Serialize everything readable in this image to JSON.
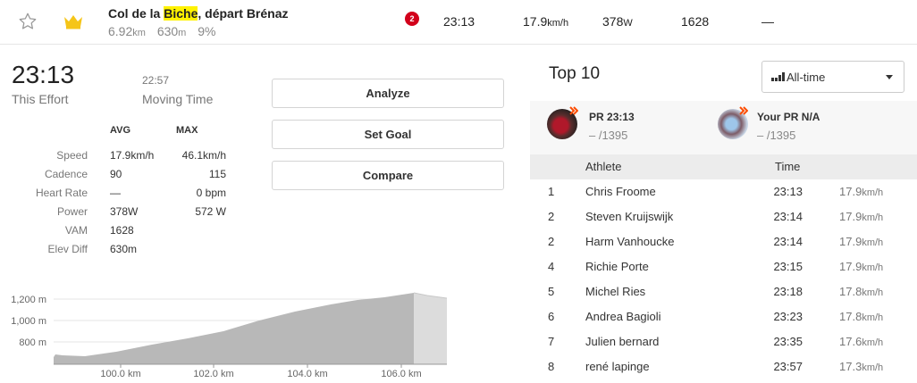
{
  "segment": {
    "name_before": "Col de la ",
    "name_highlight": "Biche",
    "name_after": ", départ Brénaz",
    "distance": "6.92",
    "distance_unit": "km",
    "elevation": "630",
    "elevation_unit": "m",
    "grade": "9%",
    "badge": "2",
    "time": "23:13",
    "speed": "17.9",
    "speed_unit": "km/h",
    "power": "378",
    "power_unit": "W",
    "vam": "1628",
    "hr": "—"
  },
  "effort": {
    "time": "23:13",
    "time_label": "This Effort",
    "moving_time": "22:57",
    "moving_label": "Moving Time"
  },
  "stats": {
    "col_avg": "AVG",
    "col_max": "MAX",
    "rows": [
      {
        "label": "Speed",
        "avg": "17.9km/h",
        "max": "46.1km/h"
      },
      {
        "label": "Cadence",
        "avg": "90",
        "max": "115"
      },
      {
        "label": "Heart Rate",
        "avg": "—",
        "max": "0 bpm"
      },
      {
        "label": "Power",
        "avg": "378W",
        "max": "572 W"
      },
      {
        "label": "VAM",
        "avg": "1628",
        "max": ""
      },
      {
        "label": "Elev Diff",
        "avg": "630m",
        "max": ""
      }
    ]
  },
  "buttons": {
    "analyze": "Analyze",
    "set_goal": "Set Goal",
    "compare": "Compare"
  },
  "elevation_chart": {
    "y_ticks": [
      "1,200 m",
      "1,000 m",
      "800 m"
    ],
    "x_ticks": [
      "100.0 km",
      "102.0 km",
      "104.0 km",
      "106.0 km"
    ]
  },
  "leaderboard": {
    "title": "Top 10",
    "filter": "All-time",
    "pr": {
      "label": "PR",
      "time": "23:13",
      "rank": "– /1395"
    },
    "your_pr": {
      "label": "Your PR",
      "value": "N/A",
      "rank": "– /1395"
    },
    "col_athlete": "Athlete",
    "col_time": "Time",
    "rows": [
      {
        "rank": "1",
        "name": "Chris Froome",
        "time": "23:13",
        "speed": "17.9"
      },
      {
        "rank": "2",
        "name": "Steven Kruijswijk",
        "time": "23:14",
        "speed": "17.9"
      },
      {
        "rank": "2",
        "name": "Harm Vanhoucke",
        "time": "23:14",
        "speed": "17.9"
      },
      {
        "rank": "4",
        "name": "Richie Porte",
        "time": "23:15",
        "speed": "17.9"
      },
      {
        "rank": "5",
        "name": "Michel Ries",
        "time": "23:18",
        "speed": "17.8"
      },
      {
        "rank": "6",
        "name": "Andrea Bagioli",
        "time": "23:23",
        "speed": "17.8"
      },
      {
        "rank": "7",
        "name": "Julien bernard",
        "time": "23:35",
        "speed": "17.6"
      },
      {
        "rank": "8",
        "name": "rené lapinge",
        "time": "23:57",
        "speed": "17.3"
      }
    ],
    "speed_unit": "km/h"
  },
  "colors": {
    "accent": "#fc4c02",
    "badge": "#d2001b",
    "highlight": "#fff200",
    "crown": "#f5c518"
  }
}
